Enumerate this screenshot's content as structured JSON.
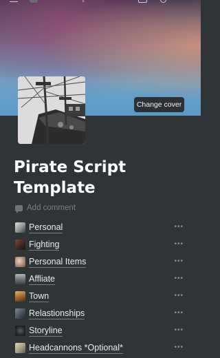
{
  "header": {
    "menu_icon": "hamburger-icon",
    "comment_icon": "comment-icon",
    "updates_icon": "clock-icon",
    "more_icon": "more-icon"
  },
  "cover": {
    "change_cover_label": "Change cover",
    "colors": [
      "#3e3350",
      "#6a6585",
      "#6fa2c4",
      "#d6967a"
    ]
  },
  "page": {
    "title": "Pirate Script Template",
    "add_comment_label": "Add comment"
  },
  "items": [
    {
      "label": "Personal",
      "icon": "personal-thumbnail",
      "color": "#b8b8b8"
    },
    {
      "label": "Fighting",
      "icon": "fighting-thumbnail",
      "color": "#5a3b33"
    },
    {
      "label": "Personal Items",
      "icon": "items-thumbnail",
      "color": "#c6a79a"
    },
    {
      "label": "Affliate",
      "icon": "affliate-thumbnail",
      "color": "#8c8f93"
    },
    {
      "label": "Town",
      "icon": "town-thumbnail",
      "color": "#b27a3c"
    },
    {
      "label": "Relastionships",
      "icon": "relationships-thumbnail",
      "color": "#55606a"
    },
    {
      "label": "Storyline",
      "icon": "storyline-thumbnail",
      "color": "#2c2c2c"
    },
    {
      "label": "Headcannons *Optional*",
      "icon": "headcannons-thumbnail",
      "color": "#b9b39a"
    }
  ]
}
